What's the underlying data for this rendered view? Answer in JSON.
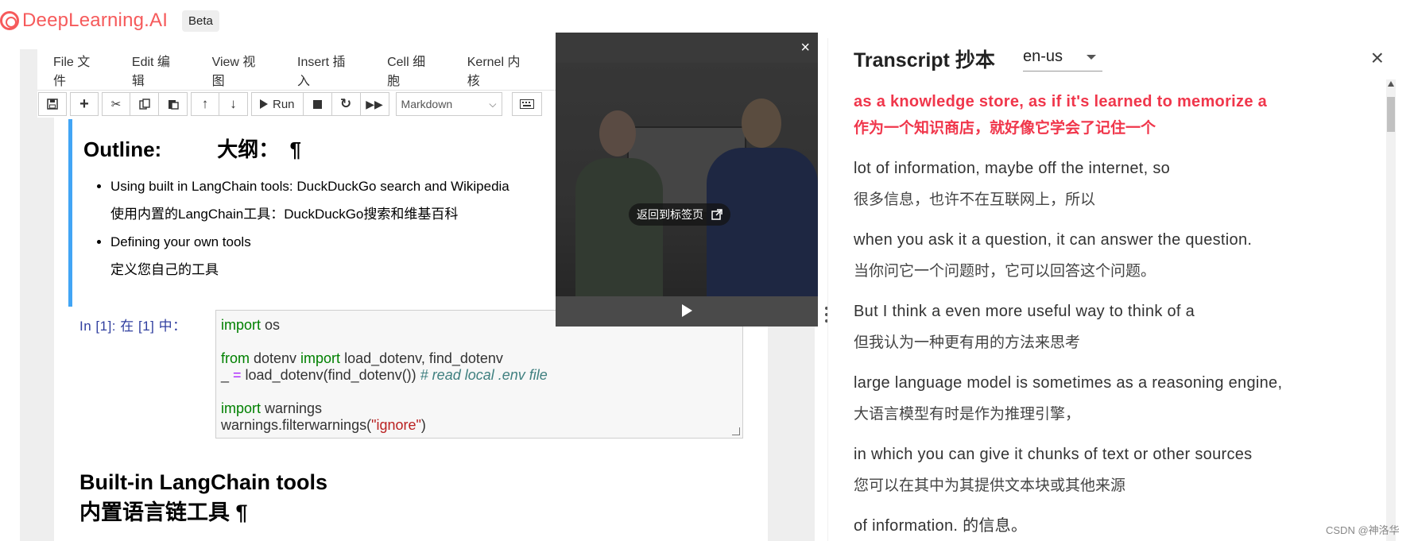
{
  "brand": {
    "name": "DeepLearning.AI",
    "badge": "Beta"
  },
  "menu": [
    "File 文件",
    "Edit 编辑",
    "View 视图",
    "Insert 插入",
    "Cell 细胞",
    "Kernel 内核"
  ],
  "toolbar": {
    "run_label": "Run",
    "cell_type": "Markdown"
  },
  "outline": {
    "heading_en": "Outline:",
    "heading_zh": "大纲：",
    "pilcrow": "¶",
    "bullets": [
      {
        "en": "Using built in LangChain tools: DuckDuckGo search and Wikipedia",
        "zh": "使用内置的LangChain工具：DuckDuckGo搜索和维基百科"
      },
      {
        "en": "Defining your own tools",
        "zh": "定义您自己的工具"
      }
    ]
  },
  "code_cell": {
    "prompt": "In [1]:  在 [1] 中：",
    "lines": {
      "l1_kw": "import",
      "l1_rest": " os",
      "l2_kw1": "from",
      "l2_mid": " dotenv ",
      "l2_kw2": "import",
      "l2_rest": " load_dotenv, find_dotenv",
      "l3_a": "_ ",
      "l3_op": "=",
      "l3_b": " load_dotenv(find_dotenv()) ",
      "l3_cm": "# read local .env file",
      "l4_kw": "import",
      "l4_rest": " warnings",
      "l5_a": "warnings.filterwarnings(",
      "l5_str": "\"ignore\"",
      "l5_b": ")"
    }
  },
  "section": {
    "title_en": "Built-in LangChain tools",
    "title_zh": "内置语言链工具 ¶"
  },
  "video": {
    "close": "×",
    "return_label": "返回到标签页"
  },
  "transcript": {
    "title": "Transcript 抄本",
    "lang": "en-us",
    "close": "×",
    "segments": [
      {
        "en": "as a knowledge store, as if it's learned to memorize a",
        "zh": "作为一个知识商店，就好像它学会了记住一个",
        "active": true
      },
      {
        "en": "lot of information, maybe off the internet, so",
        "zh": "很多信息，也许不在互联网上，所以"
      },
      {
        "en": "when you ask it a question, it can answer the question.",
        "zh": "当你问它一个问题时，它可以回答这个问题。"
      },
      {
        "en": "But I think a even more useful way to think of a",
        "zh": "但我认为一种更有用的方法来思考"
      },
      {
        "en": "large language model is sometimes as a reasoning engine,",
        "zh": "大语言模型有时是作为推理引擎，"
      },
      {
        "en": "in which you can give it chunks of text or other sources",
        "zh": "您可以在其中为其提供文本块或其他来源"
      },
      {
        "en": "of information.  的信息。",
        "zh": ""
      }
    ]
  },
  "watermark": "CSDN @神洛华",
  "colors": {
    "brand": "#f65a5b",
    "active_transcript": "#f0364b",
    "cell_border": "#42a5f5",
    "prompt": "#303f9f"
  }
}
